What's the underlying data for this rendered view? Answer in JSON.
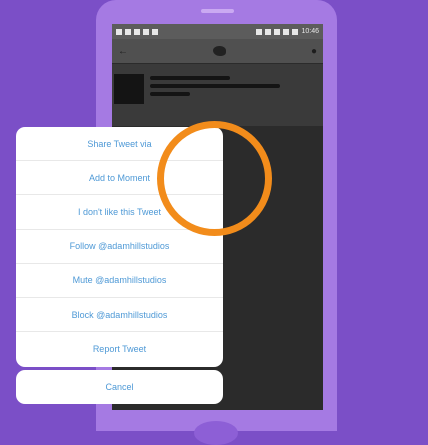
{
  "status_bar": {
    "time": "10:46"
  },
  "action_sheet": {
    "items": [
      "Share Tweet via",
      "Add to Moment",
      "I don't like this Tweet",
      "Follow @adamhillstudios",
      "Mute @adamhillstudios",
      "Block @adamhillstudios",
      "Report Tweet"
    ],
    "cancel_label": "Cancel"
  },
  "colors": {
    "background": "#7b4fc7",
    "phone": "#a57ae3",
    "action_text": "#4e99d6",
    "highlight": "#f28c1b"
  }
}
